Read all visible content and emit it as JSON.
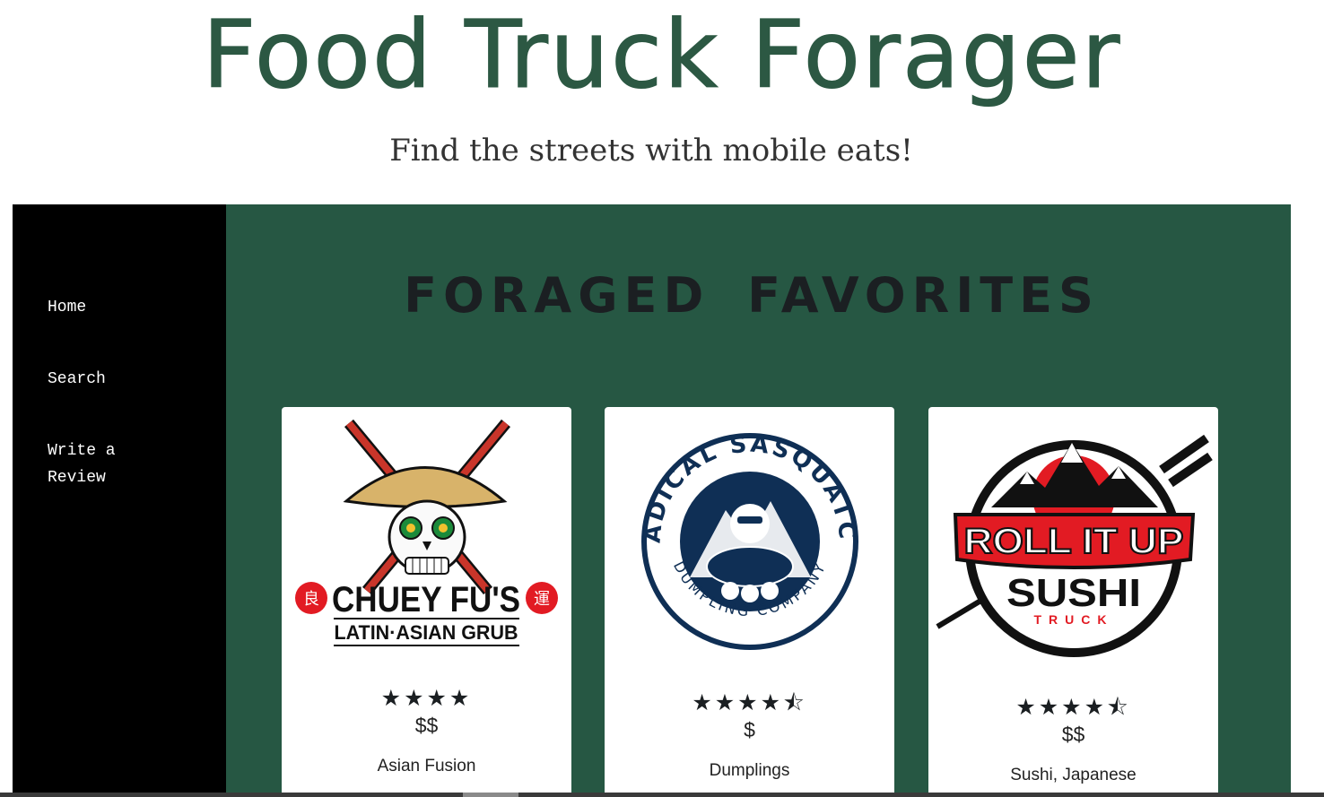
{
  "header": {
    "title": "Food Truck Forager",
    "tagline": "Find the streets with mobile eats!"
  },
  "sidebar": {
    "items": [
      {
        "label": "Home"
      },
      {
        "label": "Search"
      },
      {
        "label": "Write a Review"
      }
    ]
  },
  "main": {
    "heading": "FORAGED FAVORITES",
    "cards": [
      {
        "logo_line1": "CHUEY FU'S",
        "logo_line2": "LATIN·ASIAN GRUB",
        "logo_char_left": "良",
        "logo_char_right": "運",
        "stars": "★★★★",
        "rating": 4,
        "price": "$$",
        "cuisine": "Asian Fusion"
      },
      {
        "logo_top_arc": "RADICAL SASQUATCH",
        "logo_bottom_arc": "DUMPLING COMPANY",
        "stars": "★★★★⯪",
        "rating": 4.5,
        "price": "$",
        "cuisine": "Dumplings"
      },
      {
        "logo_banner": "ROLL IT UP",
        "logo_line2": "SUSHI",
        "logo_line3": "TRUCK",
        "stars": "★★★★⯪",
        "rating": 4.5,
        "price": "$$",
        "cuisine": "Sushi, Japanese"
      }
    ]
  },
  "colors": {
    "brand_green": "#265743",
    "title_green": "#2c5843",
    "sidebar_bg": "#000000",
    "heading_dark": "#1b1f22",
    "accent_red": "#e21b23"
  }
}
